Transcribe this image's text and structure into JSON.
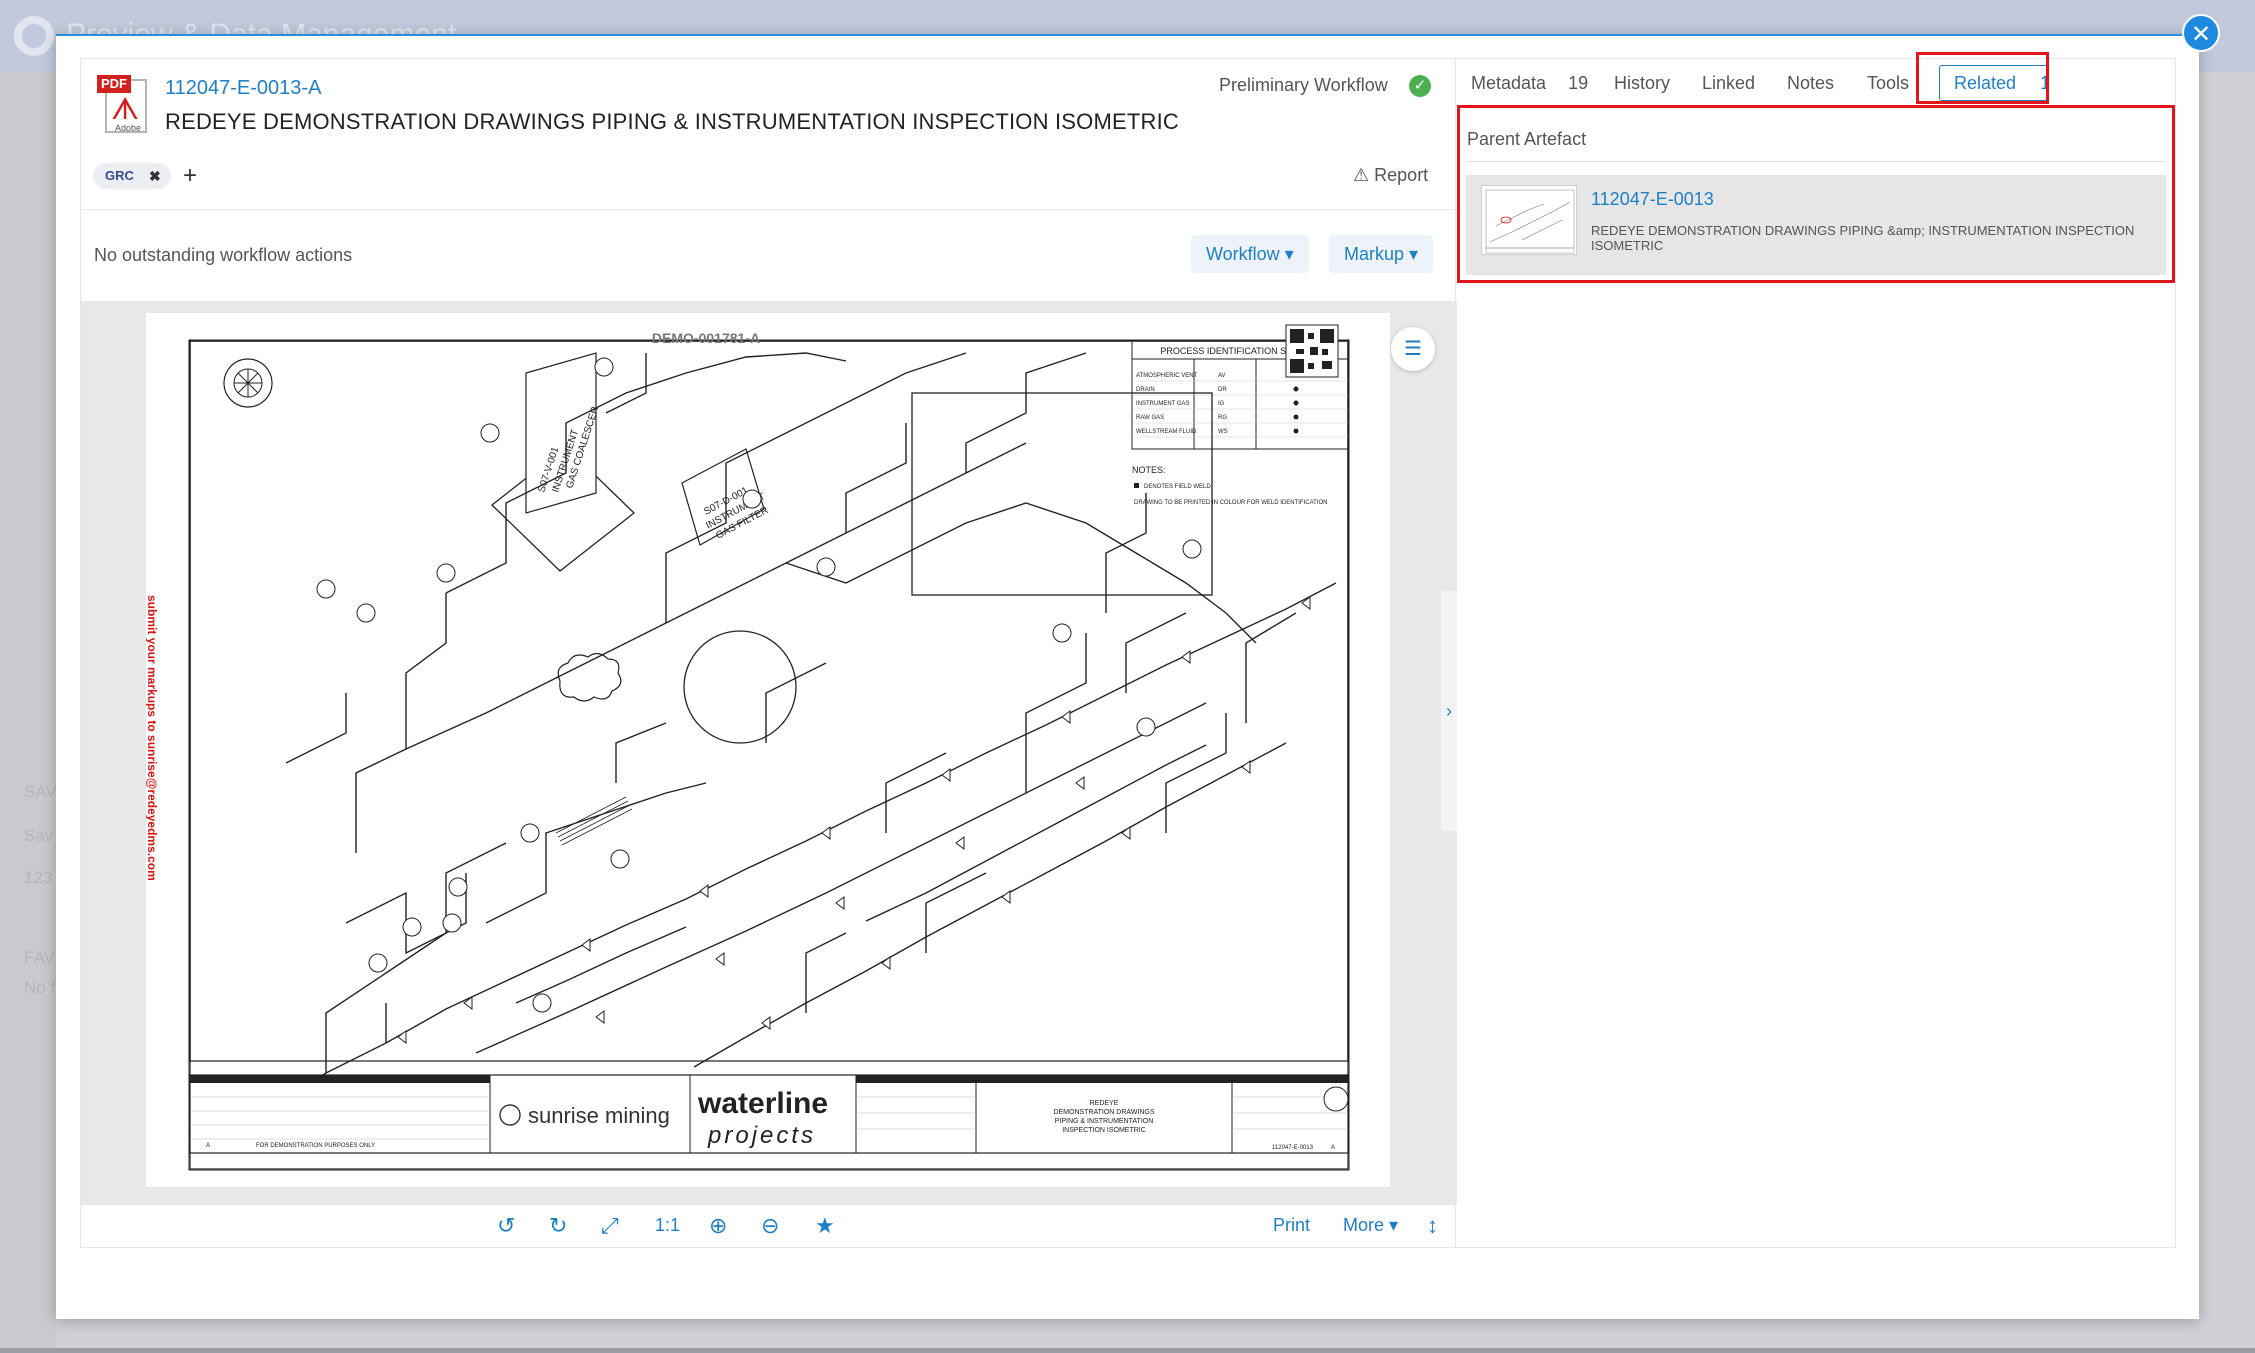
{
  "background": {
    "app_title": "Preview & Data Management",
    "side_labels": [
      "SAV",
      "Sav",
      "123",
      "FAV",
      "No f"
    ]
  },
  "document": {
    "number": "112047-E-0013-A",
    "title": "REDEYE DEMONSTRATION DRAWINGS PIPING & INSTRUMENTATION INSPECTION ISOMETRIC",
    "workflow_status": "Preliminary Workflow",
    "file_icon": "pdf-icon",
    "file_icon_tag": "PDF",
    "file_icon_brand": "Adobe",
    "tags": [
      "GRC"
    ],
    "report_label": "Report",
    "workflow_message": "No outstanding workflow actions",
    "workflow_button": "Workflow",
    "markup_button": "Markup"
  },
  "drawing": {
    "doc_code": "DEMO-001781-A",
    "side_note": "submit your markups to sunrise@redeyedms.com",
    "client": "sunrise mining",
    "consultant_line1": "waterline",
    "consultant_line2": "projects",
    "legend_title": "PROCESS IDENTIFICATION SYMBOLS",
    "legend_rows": [
      "ATMOSPHERIC VENT",
      "DRAIN",
      "INSTRUMENT GAS",
      "RAW GAS",
      "WELLSTREAM FLUID"
    ],
    "legend_codes": [
      "AV",
      "DR",
      "IG",
      "RG",
      "WS"
    ],
    "notes_title": "NOTES:",
    "notes_1": "DENOTES FIELD WELD",
    "notes_2": "DRAWING TO BE PRINTED IN COLOUR FOR WELD IDENTIFICATION",
    "title_block": "REDEYE DEMONSTRATION DRAWINGS PIPING & INSTRUMENTATION INSPECTION ISOMETRIC",
    "drawing_no": "112047-E-0013",
    "revision": "A",
    "rev_note": "FOR DEMONSTRATION PURPOSES ONLY",
    "tank_label": "S07-V-001 INSTRUMENT GAS COALESCER",
    "filter_label": "S07-D-001 INSTRUMENT GAS FILTER"
  },
  "viewer_toolbar": {
    "zoom_ratio": "1:1",
    "print": "Print",
    "more": "More",
    "icons": [
      "rotate-left-icon",
      "rotate-right-icon",
      "fit-icon",
      "zoom-in-icon",
      "zoom-out-icon",
      "star-icon",
      "vertical-resize-icon"
    ]
  },
  "tabs": [
    {
      "label": "Metadata",
      "count": "19"
    },
    {
      "label": "History",
      "count": ""
    },
    {
      "label": "Linked",
      "count": ""
    },
    {
      "label": "Notes",
      "count": ""
    },
    {
      "label": "Tools",
      "count": ""
    },
    {
      "label": "Related",
      "count": "1",
      "active": true
    }
  ],
  "related": {
    "section_title": "Parent Artefact",
    "parent_number": "112047-E-0013",
    "parent_title": "REDEYE DEMONSTRATION DRAWINGS PIPING &amp; INSTRUMENTATION INSPECTION ISOMETRIC"
  },
  "colors": {
    "accent": "#1e7fc6",
    "highlight": "#e0161c",
    "success": "#4caf50"
  }
}
